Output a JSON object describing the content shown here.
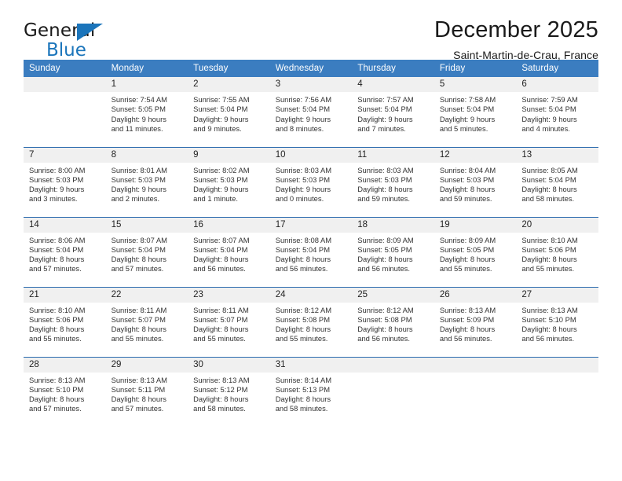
{
  "brand": {
    "name_part1": "General",
    "name_part2": "Blue",
    "triangle_icon": "triangle-icon",
    "accent_color": "#1b75bb"
  },
  "header": {
    "month_title": "December 2025",
    "location": "Saint-Martin-de-Crau, France"
  },
  "calendar": {
    "header_color": "#3b7dc0",
    "daynum_band_color": "#f0f0f0",
    "row_divider_color": "#2a6aae",
    "weekday_headers": [
      "Sunday",
      "Monday",
      "Tuesday",
      "Wednesday",
      "Thursday",
      "Friday",
      "Saturday"
    ],
    "weeks": [
      [
        {
          "day": "",
          "lines": []
        },
        {
          "day": "1",
          "lines": [
            "Sunrise: 7:54 AM",
            "Sunset: 5:05 PM",
            "Daylight: 9 hours",
            "and 11 minutes."
          ]
        },
        {
          "day": "2",
          "lines": [
            "Sunrise: 7:55 AM",
            "Sunset: 5:04 PM",
            "Daylight: 9 hours",
            "and 9 minutes."
          ]
        },
        {
          "day": "3",
          "lines": [
            "Sunrise: 7:56 AM",
            "Sunset: 5:04 PM",
            "Daylight: 9 hours",
            "and 8 minutes."
          ]
        },
        {
          "day": "4",
          "lines": [
            "Sunrise: 7:57 AM",
            "Sunset: 5:04 PM",
            "Daylight: 9 hours",
            "and 7 minutes."
          ]
        },
        {
          "day": "5",
          "lines": [
            "Sunrise: 7:58 AM",
            "Sunset: 5:04 PM",
            "Daylight: 9 hours",
            "and 5 minutes."
          ]
        },
        {
          "day": "6",
          "lines": [
            "Sunrise: 7:59 AM",
            "Sunset: 5:04 PM",
            "Daylight: 9 hours",
            "and 4 minutes."
          ]
        }
      ],
      [
        {
          "day": "7",
          "lines": [
            "Sunrise: 8:00 AM",
            "Sunset: 5:03 PM",
            "Daylight: 9 hours",
            "and 3 minutes."
          ]
        },
        {
          "day": "8",
          "lines": [
            "Sunrise: 8:01 AM",
            "Sunset: 5:03 PM",
            "Daylight: 9 hours",
            "and 2 minutes."
          ]
        },
        {
          "day": "9",
          "lines": [
            "Sunrise: 8:02 AM",
            "Sunset: 5:03 PM",
            "Daylight: 9 hours",
            "and 1 minute."
          ]
        },
        {
          "day": "10",
          "lines": [
            "Sunrise: 8:03 AM",
            "Sunset: 5:03 PM",
            "Daylight: 9 hours",
            "and 0 minutes."
          ]
        },
        {
          "day": "11",
          "lines": [
            "Sunrise: 8:03 AM",
            "Sunset: 5:03 PM",
            "Daylight: 8 hours",
            "and 59 minutes."
          ]
        },
        {
          "day": "12",
          "lines": [
            "Sunrise: 8:04 AM",
            "Sunset: 5:03 PM",
            "Daylight: 8 hours",
            "and 59 minutes."
          ]
        },
        {
          "day": "13",
          "lines": [
            "Sunrise: 8:05 AM",
            "Sunset: 5:04 PM",
            "Daylight: 8 hours",
            "and 58 minutes."
          ]
        }
      ],
      [
        {
          "day": "14",
          "lines": [
            "Sunrise: 8:06 AM",
            "Sunset: 5:04 PM",
            "Daylight: 8 hours",
            "and 57 minutes."
          ]
        },
        {
          "day": "15",
          "lines": [
            "Sunrise: 8:07 AM",
            "Sunset: 5:04 PM",
            "Daylight: 8 hours",
            "and 57 minutes."
          ]
        },
        {
          "day": "16",
          "lines": [
            "Sunrise: 8:07 AM",
            "Sunset: 5:04 PM",
            "Daylight: 8 hours",
            "and 56 minutes."
          ]
        },
        {
          "day": "17",
          "lines": [
            "Sunrise: 8:08 AM",
            "Sunset: 5:04 PM",
            "Daylight: 8 hours",
            "and 56 minutes."
          ]
        },
        {
          "day": "18",
          "lines": [
            "Sunrise: 8:09 AM",
            "Sunset: 5:05 PM",
            "Daylight: 8 hours",
            "and 56 minutes."
          ]
        },
        {
          "day": "19",
          "lines": [
            "Sunrise: 8:09 AM",
            "Sunset: 5:05 PM",
            "Daylight: 8 hours",
            "and 55 minutes."
          ]
        },
        {
          "day": "20",
          "lines": [
            "Sunrise: 8:10 AM",
            "Sunset: 5:06 PM",
            "Daylight: 8 hours",
            "and 55 minutes."
          ]
        }
      ],
      [
        {
          "day": "21",
          "lines": [
            "Sunrise: 8:10 AM",
            "Sunset: 5:06 PM",
            "Daylight: 8 hours",
            "and 55 minutes."
          ]
        },
        {
          "day": "22",
          "lines": [
            "Sunrise: 8:11 AM",
            "Sunset: 5:07 PM",
            "Daylight: 8 hours",
            "and 55 minutes."
          ]
        },
        {
          "day": "23",
          "lines": [
            "Sunrise: 8:11 AM",
            "Sunset: 5:07 PM",
            "Daylight: 8 hours",
            "and 55 minutes."
          ]
        },
        {
          "day": "24",
          "lines": [
            "Sunrise: 8:12 AM",
            "Sunset: 5:08 PM",
            "Daylight: 8 hours",
            "and 55 minutes."
          ]
        },
        {
          "day": "25",
          "lines": [
            "Sunrise: 8:12 AM",
            "Sunset: 5:08 PM",
            "Daylight: 8 hours",
            "and 56 minutes."
          ]
        },
        {
          "day": "26",
          "lines": [
            "Sunrise: 8:13 AM",
            "Sunset: 5:09 PM",
            "Daylight: 8 hours",
            "and 56 minutes."
          ]
        },
        {
          "day": "27",
          "lines": [
            "Sunrise: 8:13 AM",
            "Sunset: 5:10 PM",
            "Daylight: 8 hours",
            "and 56 minutes."
          ]
        }
      ],
      [
        {
          "day": "28",
          "lines": [
            "Sunrise: 8:13 AM",
            "Sunset: 5:10 PM",
            "Daylight: 8 hours",
            "and 57 minutes."
          ]
        },
        {
          "day": "29",
          "lines": [
            "Sunrise: 8:13 AM",
            "Sunset: 5:11 PM",
            "Daylight: 8 hours",
            "and 57 minutes."
          ]
        },
        {
          "day": "30",
          "lines": [
            "Sunrise: 8:13 AM",
            "Sunset: 5:12 PM",
            "Daylight: 8 hours",
            "and 58 minutes."
          ]
        },
        {
          "day": "31",
          "lines": [
            "Sunrise: 8:14 AM",
            "Sunset: 5:13 PM",
            "Daylight: 8 hours",
            "and 58 minutes."
          ]
        },
        {
          "day": "",
          "lines": []
        },
        {
          "day": "",
          "lines": []
        },
        {
          "day": "",
          "lines": []
        }
      ]
    ]
  }
}
